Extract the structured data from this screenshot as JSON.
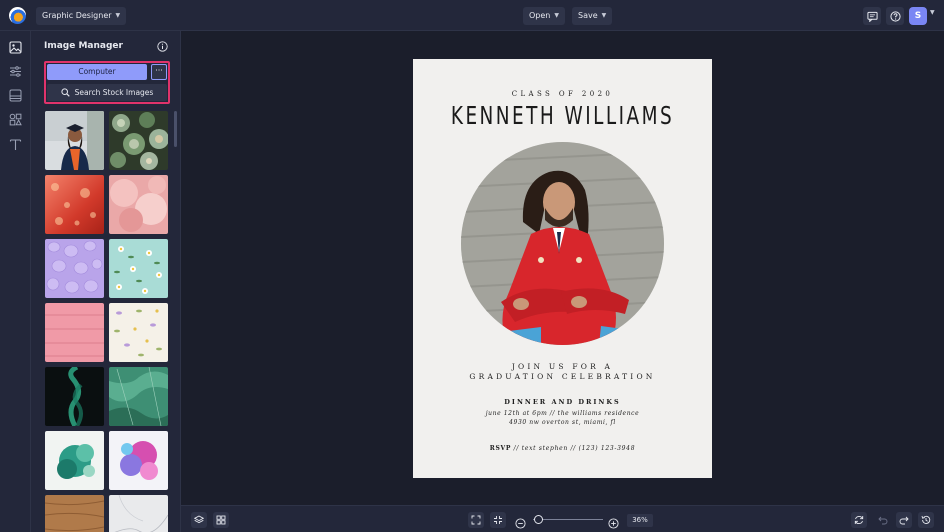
{
  "header": {
    "mode_label": "Graphic Designer",
    "open_label": "Open",
    "save_label": "Save",
    "avatar_initial": "S"
  },
  "panel": {
    "title": "Image Manager",
    "computer_label": "Computer",
    "more_label": "···",
    "search_stock_label": "Search Stock Images"
  },
  "document": {
    "class_line": "CLASS OF 2020",
    "name": "KENNETH WILLIAMS",
    "join_line1": "JOIN US FOR A",
    "join_line2": "GRADUATION CELEBRATION",
    "dinner_line": "DINNER AND DRINKS",
    "date_line": "june 12th at 6pm // the williams residence",
    "address_line": "4930 nw overton st, miami, fl",
    "rsvp_label": "RSVP",
    "rsvp_rest": " // text stephen // (123) 123-3948"
  },
  "footer": {
    "zoom": "36%"
  },
  "colors": {
    "accent": "#8f9bfa",
    "highlight": "#e0336b",
    "gown": "#d8262c"
  }
}
